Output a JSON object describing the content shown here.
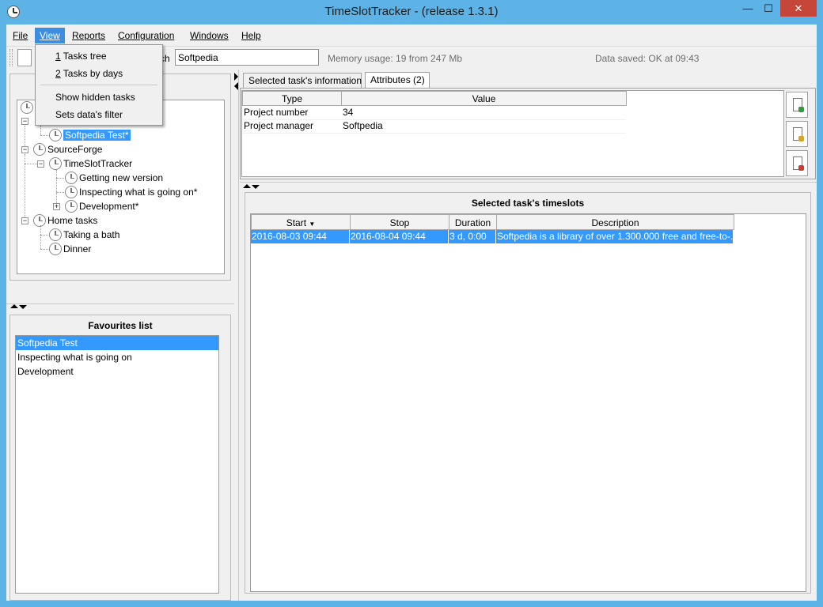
{
  "window": {
    "title": "TimeSlotTracker - (release 1.3.1)",
    "minimize_glyph": "—",
    "maximize_glyph": "☐",
    "close_glyph": "✕"
  },
  "menubar": {
    "items": [
      "File",
      "View",
      "Reports",
      "Configuration",
      "Windows",
      "Help"
    ],
    "active": "View"
  },
  "view_menu": {
    "items": [
      {
        "key": "1",
        "label": " Tasks tree"
      },
      {
        "key": "2",
        "label": " Tasks by days"
      },
      {
        "key": "",
        "label": "Show hidden tasks"
      },
      {
        "key": "",
        "label": "Sets data's filter"
      }
    ]
  },
  "toolbar": {
    "search_label": "ch",
    "search_value": "Softpedia",
    "memory_usage": "Memory usage: 19 from 247 Mb",
    "data_saved": "Data saved: OK at 09:43"
  },
  "tasks_tree": {
    "nodes": [
      {
        "label": "Softpedia Test*",
        "selected": true
      },
      {
        "label": "SourceForge"
      },
      {
        "label": "TimeSlotTracker"
      },
      {
        "label": "Getting new version"
      },
      {
        "label": "Inspecting what is going on*"
      },
      {
        "label": "Development*"
      },
      {
        "label": "Home tasks"
      },
      {
        "label": "Taking a bath"
      },
      {
        "label": "Dinner"
      }
    ],
    "expander_minus": "−",
    "expander_plus": "+"
  },
  "favourites": {
    "title": "Favourites list",
    "items": [
      "Softpedia Test",
      "Inspecting what is going on",
      "Development"
    ],
    "selected_index": 0
  },
  "task_info": {
    "tabs": [
      "Selected task's information",
      "Attributes (2)"
    ],
    "active_tab": "Attributes (2)",
    "columns": [
      "Type",
      "Value"
    ],
    "rows": [
      {
        "type": "Project number",
        "value": "34"
      },
      {
        "type": "Project manager",
        "value": "Softpedia"
      }
    ],
    "side_buttons": [
      "add-attribute-icon",
      "edit-attribute-icon",
      "delete-attribute-icon"
    ]
  },
  "timeslots": {
    "title": "Selected task's timeslots",
    "columns": [
      "Start",
      "Stop",
      "Duration",
      "Description"
    ],
    "sort_indicator": "▼",
    "rows": [
      {
        "start": "2016-08-03 09:44",
        "stop": "2016-08-04 09:44",
        "duration": "3 d, 0:00",
        "description": "Softpedia is a library of over 1.300.000 free and free-to-..."
      }
    ]
  },
  "colors": {
    "titlebar": "#5eb3e6",
    "selection": "#3399ff",
    "close_button": "#c7463a",
    "menu_active": "#3d8ee0"
  }
}
